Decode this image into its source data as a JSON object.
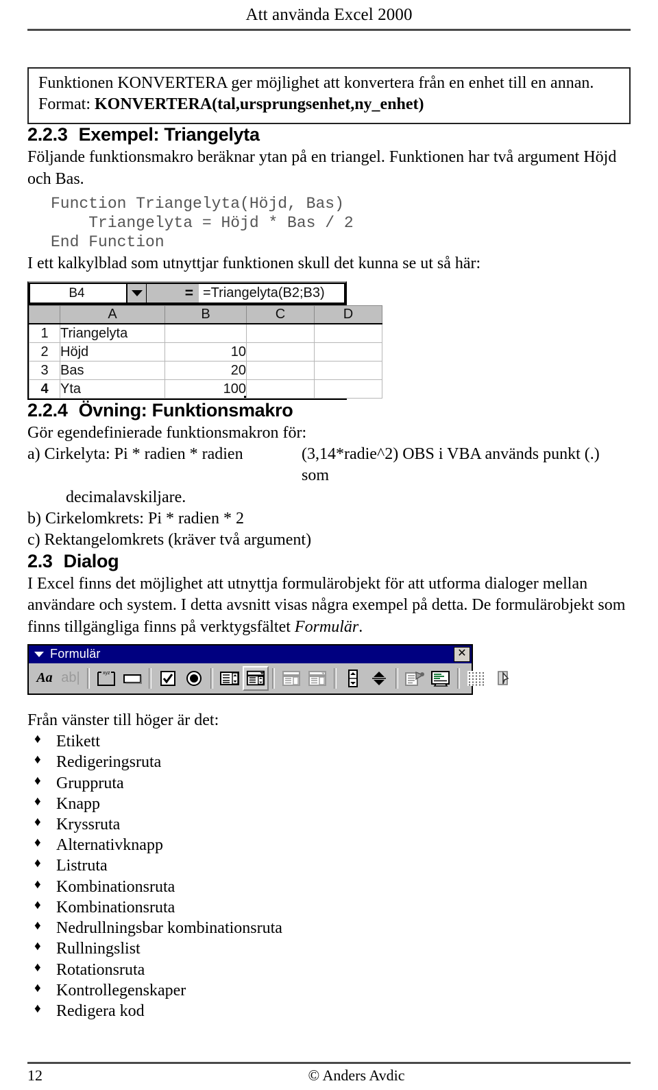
{
  "document": {
    "running_head": "Att använda Excel 2000",
    "footer": {
      "page_number": "12",
      "copyright": "© Anders Avdic"
    }
  },
  "note_box": {
    "line1": "Funktionen KONVERTERA ger möjlighet att konvertera från en enhet till en annan.",
    "line2_label": "Format: ",
    "line2_value": "KONVERTERA(tal,ursprungsenhet,ny_enhet)"
  },
  "section_223": {
    "number": "2.2.3",
    "title": "Exempel: Triangelyta",
    "paragraph": "Följande funktionsmakro beräknar ytan på en triangel. Funktionen har två argument Höjd och Bas.",
    "code": "Function Triangelyta(Höjd, Bas)\n    Triangelyta = Höjd * Bas / 2\nEnd Function",
    "lead_in": "I ett kalkylblad som utnyttjar funktionen skull det kunna se ut så här:"
  },
  "excel": {
    "name_box": "B4",
    "equals_label": "=",
    "formula": "=Triangelyta(B2;B3)",
    "column_headers": [
      "",
      "A",
      "B",
      "C",
      "D"
    ],
    "rows": [
      {
        "header": "1",
        "a": "Triangelyta",
        "b": "",
        "c": "",
        "d": "",
        "selected": false
      },
      {
        "header": "2",
        "a": "Höjd",
        "b": "10",
        "c": "",
        "d": "",
        "selected": false
      },
      {
        "header": "3",
        "a": "Bas",
        "b": "20",
        "c": "",
        "d": "",
        "selected": false
      },
      {
        "header": "4",
        "a": "Yta",
        "b": "100",
        "c": "",
        "d": "",
        "selected": true
      }
    ]
  },
  "section_224": {
    "number": "2.2.4",
    "title": "Övning: Funktionsmakro",
    "intro": "Gör egendefinierade funktionsmakron för:",
    "items": [
      {
        "left": "a) Cirkelyta: Pi * radien * radien",
        "right": "(3,14*radie^2) OBS i VBA används punkt (.) som"
      },
      {
        "left": "decimalavskiljare.",
        "right": ""
      },
      {
        "left": "b) Cirkelomkrets: Pi * radien * 2",
        "right": ""
      },
      {
        "left": "c) Rektangelomkrets (kräver två argument)",
        "right": ""
      }
    ]
  },
  "section_23": {
    "number": "2.3",
    "title": "Dialog",
    "paragraph_part1": "I Excel finns det möjlighet att utnyttja formulärobjekt för att utforma dialoger mellan användare och system. I detta avsnitt visas några exempel på detta. De formulärobjekt som finns tillgängliga finns på verktygsfältet ",
    "paragraph_emph": "Formulär",
    "paragraph_part2": "."
  },
  "toolbar": {
    "title": "Formulär",
    "close_label": "✕",
    "buttons": [
      {
        "name": "label-icon",
        "glyph": "Aa"
      },
      {
        "name": "edit-box-icon",
        "glyph": "ab|"
      },
      {
        "name": "group-box-icon",
        "glyph": "xyz"
      },
      {
        "name": "button-icon",
        "glyph": ""
      },
      {
        "name": "check-box-icon",
        "glyph": "✔"
      },
      {
        "name": "option-button-icon",
        "glyph": "●"
      },
      {
        "name": "list-box-icon",
        "glyph": ""
      },
      {
        "name": "combo-box-icon",
        "glyph": ""
      },
      {
        "name": "combination-list-edit-icon",
        "glyph": ""
      },
      {
        "name": "combination-drop-down-edit-icon",
        "glyph": ""
      },
      {
        "name": "scroll-bar-icon",
        "glyph": ""
      },
      {
        "name": "spinner-icon",
        "glyph": ""
      },
      {
        "name": "control-properties-icon",
        "glyph": ""
      },
      {
        "name": "edit-code-icon",
        "glyph": ""
      },
      {
        "name": "toggle-grid-icon",
        "glyph": ""
      },
      {
        "name": "run-dialog-icon",
        "glyph": ""
      }
    ]
  },
  "object_list": {
    "lead_in": "Från vänster till höger är det:",
    "items": [
      "Etikett",
      "Redigeringsruta",
      "Gruppruta",
      "Knapp",
      "Kryssruta",
      "Alternativknapp",
      "Listruta",
      "Kombinationsruta",
      "Kombinationsruta",
      "Nedrullningsbar kombinationsruta",
      "Rullningslist",
      "Rotationsruta",
      "Kontrollegenskaper",
      "Redigera kod"
    ]
  }
}
